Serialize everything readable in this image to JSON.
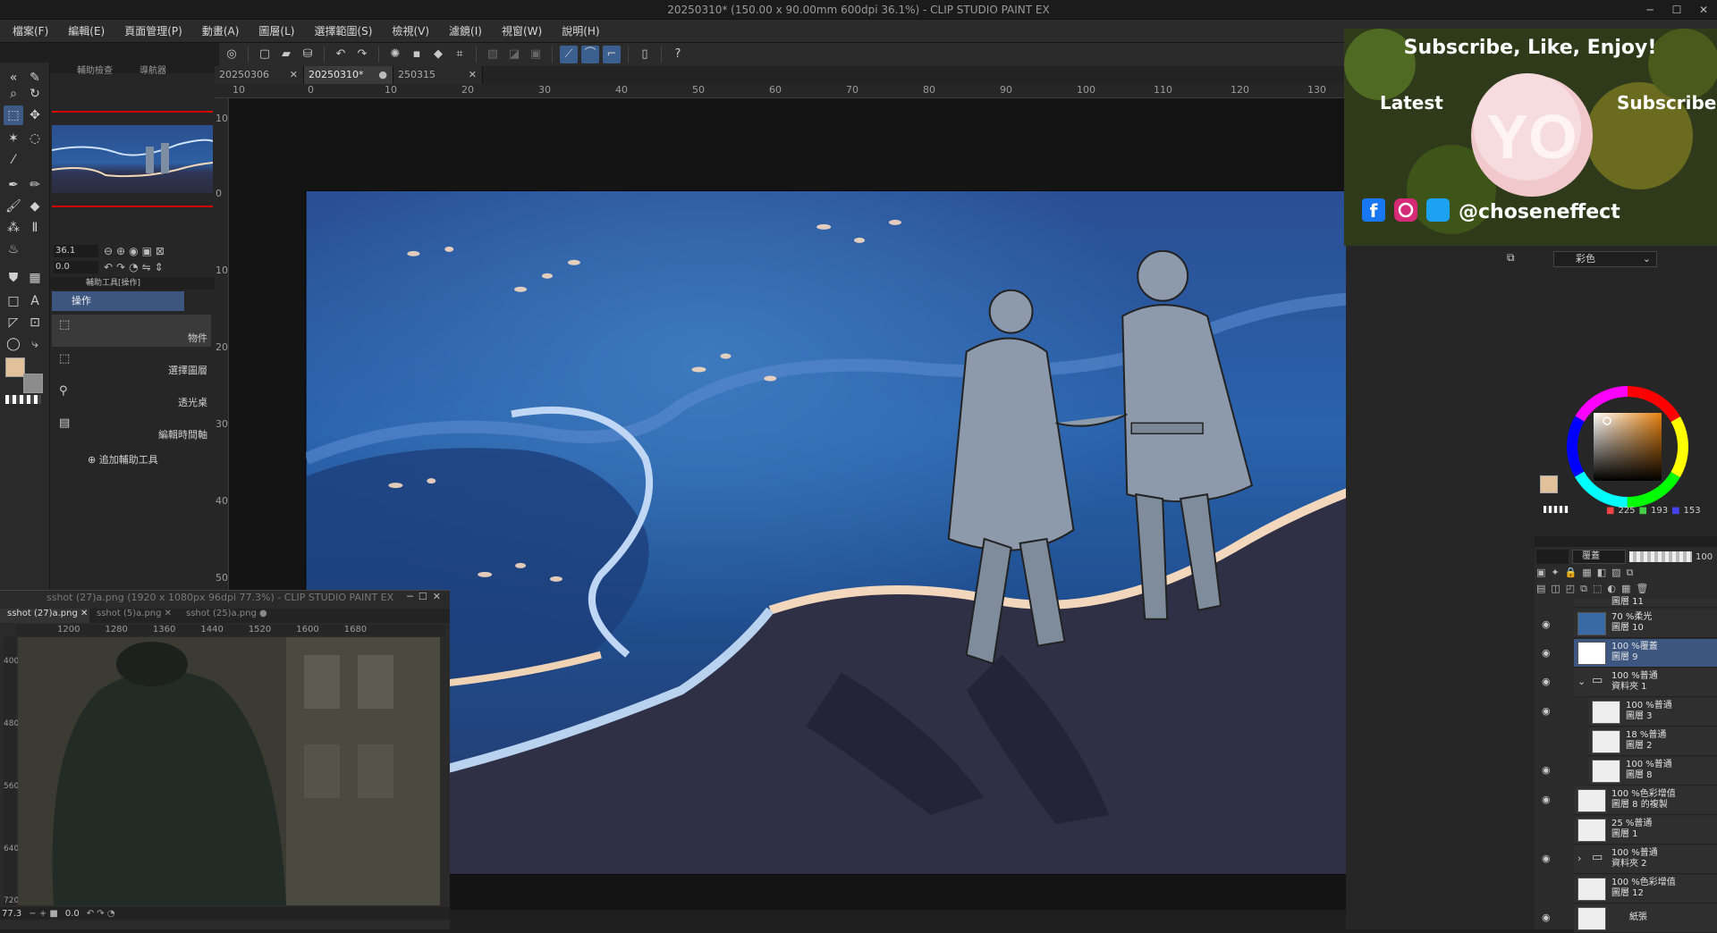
{
  "window": {
    "title": "20250310* (150.00 x 90.00mm 600dpi 36.1%) - CLIP STUDIO PAINT EX"
  },
  "menu": [
    "檔案(F)",
    "編輯(E)",
    "頁面管理(P)",
    "動畫(A)",
    "圖層(L)",
    "選擇範圍(S)",
    "檢視(V)",
    "濾鏡(I)",
    "視窗(W)",
    "說明(H)"
  ],
  "doc_tabs": [
    {
      "label": "20250306",
      "active": false
    },
    {
      "label": "20250310*",
      "active": true
    },
    {
      "label": "250315",
      "active": false
    }
  ],
  "ruler_top": [
    "10",
    "0",
    "10",
    "20",
    "30",
    "40",
    "50",
    "60",
    "70",
    "80",
    "90",
    "100",
    "110",
    "120",
    "130"
  ],
  "ruler_left": [
    "10",
    "0",
    "10",
    "20",
    "30",
    "40",
    "50"
  ],
  "navigator": {
    "tabs": [
      "輔助檢查",
      "導航器"
    ],
    "zoom": "36.1",
    "rotation": "0.0"
  },
  "sub_tool": {
    "header": "輔助工具[操作]",
    "group": "操作",
    "items": [
      "物件",
      "選擇圖層",
      "透光桌",
      "編輯時間軸"
    ],
    "add_label": "追加輔助工具"
  },
  "float_window": {
    "title": "sshot (27)a.png (1920 x 1080px 96dpi 77.3%) - CLIP STUDIO PAINT EX",
    "tabs": [
      "sshot (27)a.png",
      "sshot (5)a.png",
      "sshot (25)a.png"
    ],
    "ruler": [
      "1200",
      "1280",
      "1360",
      "1440",
      "1520",
      "1600",
      "1680"
    ],
    "ruler_left": [
      "400",
      "480",
      "560",
      "640",
      "720"
    ],
    "zoom": "77.3",
    "rotation": "0.0"
  },
  "banner": {
    "headline": "Subscribe, Like, Enjoy!",
    "left_label": "Latest",
    "right_label": "Subscribe",
    "logo_text": "YO",
    "handle": "@choseneffect"
  },
  "color_panel": {
    "mode": "彩色",
    "r": "225",
    "g": "193",
    "b": "153",
    "main_color": "#e1c199"
  },
  "layer_panel": {
    "blend_mode": "覆蓋",
    "opacity": "100",
    "layers": [
      {
        "line1": "圖層 11",
        "line2": "",
        "selected": false,
        "visible": false,
        "folder": false
      },
      {
        "line1": "70 %柔光",
        "line2": "圖層 10",
        "selected": false,
        "visible": true,
        "folder": false
      },
      {
        "line1": "100 %覆蓋",
        "line2": "圖層 9",
        "selected": true,
        "visible": true,
        "folder": false
      },
      {
        "line1": "100 %普通",
        "line2": "資料夾 1",
        "selected": false,
        "visible": true,
        "folder": true
      },
      {
        "line1": "100 %普通",
        "line2": "圖層 3",
        "selected": false,
        "visible": true,
        "folder": false
      },
      {
        "line1": "18 %普通",
        "line2": "圖層 2",
        "selected": false,
        "visible": false,
        "folder": false
      },
      {
        "line1": "100 %普通",
        "line2": "圖層 8",
        "selected": false,
        "visible": true,
        "folder": false
      },
      {
        "line1": "100 %色彩增值",
        "line2": "圖層 8 的複製",
        "selected": false,
        "visible": true,
        "folder": false
      },
      {
        "line1": "25 %普通",
        "line2": "圖層 1",
        "selected": false,
        "visible": false,
        "folder": false
      },
      {
        "line1": "100 %普通",
        "line2": "資料夾 2",
        "selected": false,
        "visible": true,
        "folder": true
      },
      {
        "line1": "100 %色彩增值",
        "line2": "圖層 12",
        "selected": false,
        "visible": false,
        "folder": false
      },
      {
        "line1": "紙張",
        "line2": "",
        "selected": false,
        "visible": true,
        "folder": false
      }
    ]
  }
}
